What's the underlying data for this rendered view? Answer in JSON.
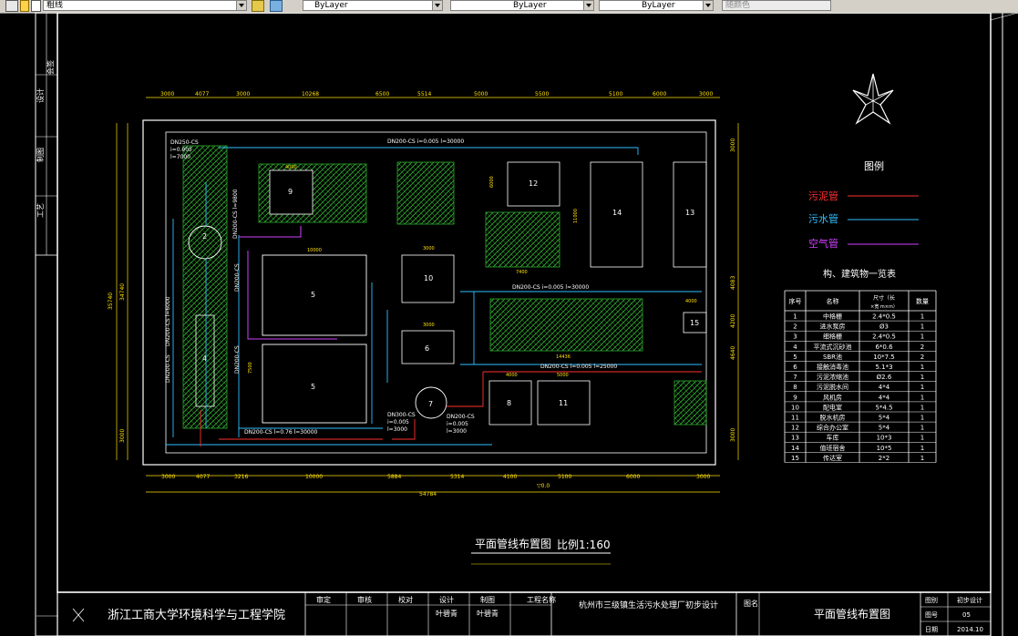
{
  "toolbar": {
    "linetype_label": "粗线",
    "color_control": "ByLayer",
    "linetype_control": "ByLayer",
    "lineweight_control": "ByLayer",
    "plotstyle_control": "随颜色"
  },
  "side_panel": {
    "labels": [
      "设计",
      "制图",
      "工艺",
      "会签"
    ]
  },
  "drawing": {
    "dim_top": [
      "3000",
      "4077",
      "3000",
      "10268",
      "6500",
      "5514",
      "5000",
      "5500",
      "5100",
      "6000",
      "3000"
    ],
    "dim_bottom": [
      "3000",
      "4077",
      "3216",
      "10000",
      "5884",
      "5314",
      "4100",
      "5100",
      "6000",
      "3000"
    ],
    "dim_total": "54784",
    "dim_left_outer": "35740",
    "dim_left_inner": "34740",
    "dim_left_lower": "3000",
    "dim_right": [
      "3000",
      "4083",
      "4200",
      "4640",
      "3000"
    ],
    "elev_small": "▽0.0",
    "pipe_labels": {
      "top": "DN200-CS  i=0.005  l=30000",
      "left_top": "DN250-CS",
      "left_top_i": "i=0.005",
      "left_top_l": "l=7000",
      "left_vertical_1": "DN200-CS  l=9800",
      "left_vertical_2": "DN200-CS  l=6000",
      "left_vertical_3": "DN200-CS",
      "center_vertical_1": "DN200-CS",
      "center_vertical_2": "DN200-CS",
      "mid_right": "DN200-CS  i=0.005  l=30000",
      "mid_lower": "DN200-CS  i=0.005  l=25000",
      "bottom_left": "DN200-CS  l=0.76  l=30000",
      "bottom_mid": "DN300-CS",
      "bottom_mid_i": "i=0.005",
      "bottom_mid_l": "l=3000",
      "bottom_right": "DN200-CS",
      "bottom_right_i": "i=0.005",
      "bottom_right_l": "l=3000"
    },
    "buildings": [
      {
        "id": "2",
        "label": "2"
      },
      {
        "id": "9",
        "label": "9"
      },
      {
        "id": "12",
        "label": "12"
      },
      {
        "id": "14",
        "label": "14"
      },
      {
        "id": "13",
        "label": "13"
      },
      {
        "id": "5a",
        "label": "5"
      },
      {
        "id": "5b",
        "label": "5"
      },
      {
        "id": "10",
        "label": "10"
      },
      {
        "id": "6",
        "label": "6"
      },
      {
        "id": "15",
        "label": "15"
      },
      {
        "id": "7",
        "label": "7"
      },
      {
        "id": "8",
        "label": "8"
      },
      {
        "id": "11",
        "label": "11"
      },
      {
        "id": "4",
        "label": "4"
      }
    ],
    "building_dims": {
      "b9_w": "4000",
      "b12_h": "6000",
      "b14_h": "11000",
      "b7400": "7400",
      "b5_w": "10000",
      "b10_w": "3000",
      "b6_w": "3000",
      "b8_w": "4000",
      "b11_w": "5000",
      "b15_w": "4000",
      "b14436": "14436",
      "b5_h": "7500"
    },
    "title": "平面管线布置图",
    "scale": "比例1:160"
  },
  "legend": {
    "title": "图例",
    "items": [
      {
        "label": "污泥管",
        "color": "#ff3030"
      },
      {
        "label": "污水管",
        "color": "#30c0ff"
      },
      {
        "label": "空气管",
        "color": "#d040ff"
      }
    ]
  },
  "structure_table": {
    "title": "构、建筑物一览表",
    "headers": [
      "序号",
      "名称",
      "尺寸（长×宽 m×m）",
      "数量"
    ],
    "rows": [
      [
        "1",
        "中格栅",
        "2.4*0.5",
        "1"
      ],
      [
        "2",
        "进水泵房",
        "Ø3",
        "1"
      ],
      [
        "3",
        "细格栅",
        "2.4*0.5",
        "1"
      ],
      [
        "4",
        "平流式沉砂池",
        "6*0.6",
        "2"
      ],
      [
        "5",
        "SBR池",
        "10*7.5",
        "2"
      ],
      [
        "6",
        "接触消毒池",
        "5.1*3",
        "1"
      ],
      [
        "7",
        "污泥浓缩池",
        "Ø2.6",
        "1"
      ],
      [
        "8",
        "污泥脱水间",
        "4*4",
        "1"
      ],
      [
        "9",
        "风机房",
        "4*4",
        "1"
      ],
      [
        "10",
        "配电室",
        "5*4.5",
        "1"
      ],
      [
        "11",
        "脱水机房",
        "5*4",
        "1"
      ],
      [
        "12",
        "综合办公室",
        "5*4",
        "1"
      ],
      [
        "13",
        "车库",
        "10*3",
        "1"
      ],
      [
        "14",
        "值班宿舍",
        "10*5",
        "1"
      ],
      [
        "15",
        "传达室",
        "2*2",
        "1"
      ]
    ]
  },
  "title_block": {
    "school": "浙江工商大学环境科学与工程学院",
    "roles": [
      "审定",
      "审核",
      "校对",
      "设计",
      "制图",
      "工程名称"
    ],
    "role_values": [
      "",
      "",
      "",
      "叶碧青",
      "叶碧青",
      ""
    ],
    "project": "杭州市三级镇生活污水处理厂初步设计",
    "drawing_name_label": "图名",
    "drawing_name": "平面管线布置图",
    "meta_labels": [
      "图别",
      "图号",
      "日期"
    ],
    "meta_values": [
      "初步设计",
      "05",
      "2014.10"
    ]
  }
}
